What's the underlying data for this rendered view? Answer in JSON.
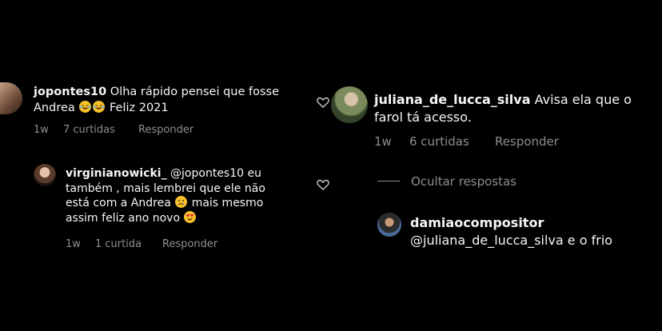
{
  "left": {
    "comment": {
      "username": "jopontes10",
      "text_part1": "Olha rápido pensei que fosse",
      "text_part2_prefix": "Andrea",
      "text_part2_suffix": "Feliz 2021",
      "time": "1w",
      "likes": "7 curtidas",
      "reply": "Responder"
    },
    "reply": {
      "username": "virginianowicki_",
      "mention": "@jopontes10",
      "line1_end": "eu",
      "line2": "também , mais lembrei que ele não",
      "line3_prefix": "está com a Andrea",
      "line3_suffix": "mais mesmo",
      "line4": "assim feliz ano novo",
      "time": "1w",
      "likes": "1 curtida",
      "reply": "Responder"
    }
  },
  "right": {
    "comment": {
      "username": "juliana_de_lucca_silva",
      "text_line1": "Avisa ela que o",
      "text_line2": "farol tá acesso.",
      "time": "1w",
      "likes": "6 curtidas",
      "reply": "Responder"
    },
    "hide_replies": "Ocultar respostas",
    "reply": {
      "username": "damiaocompositor",
      "text": "@juliana_de_lucca_silva e o frio"
    }
  },
  "icons": {
    "heart": "heart-outline-icon",
    "laughing": "laughing-emoji-icon",
    "sad": "sad-emoji-icon",
    "heart_eyes": "heart-eyes-emoji-icon"
  },
  "colors": {
    "background": "#000000",
    "text": "#f5f5f5",
    "muted": "#8e8e8e"
  }
}
